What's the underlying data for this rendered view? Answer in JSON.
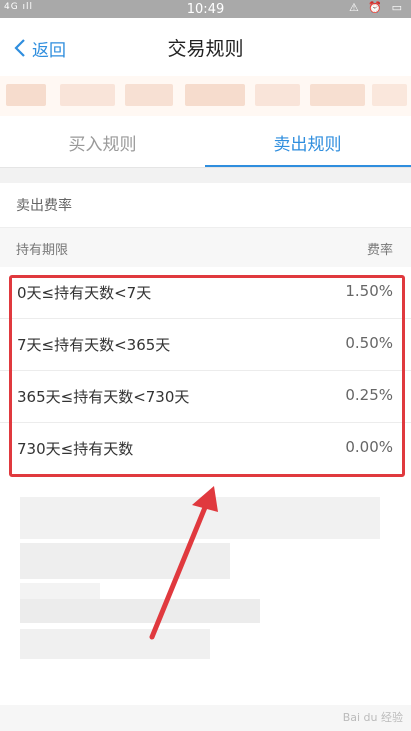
{
  "status_bar": {
    "signal": "4G ıll",
    "time": "10:49",
    "sys_icons": "⚠ ⏰ ▭"
  },
  "nav": {
    "back_label": "返回",
    "title": "交易规则"
  },
  "tabs": [
    {
      "label": "买入规则",
      "active": false
    },
    {
      "label": "卖出规则",
      "active": true
    }
  ],
  "fee_section": {
    "title": "卖出费率",
    "header": {
      "period": "持有期限",
      "rate": "费率"
    },
    "rows": [
      {
        "period": "0天≤持有天数<7天",
        "rate": "1.50%"
      },
      {
        "period": "7天≤持有天数<365天",
        "rate": "0.50%"
      },
      {
        "period": "365天≤持有天数<730天",
        "rate": "0.25%"
      },
      {
        "period": "730天≤持有天数",
        "rate": "0.00%"
      }
    ]
  },
  "colors": {
    "accent": "#2f8ede",
    "highlight": "#e0393e"
  },
  "watermark": "Bai du 经验"
}
